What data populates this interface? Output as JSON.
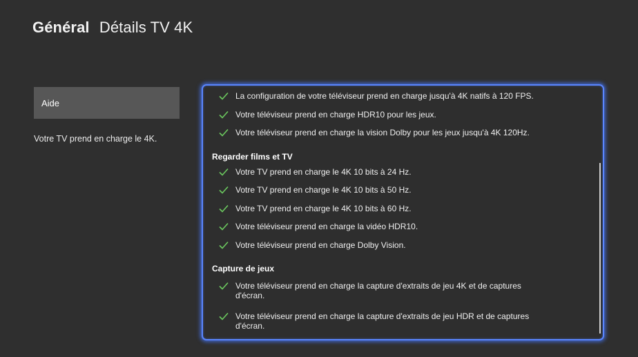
{
  "header": {
    "section": "Général",
    "page": "Détails TV 4K"
  },
  "sidebar": {
    "help_label": "Aide",
    "help_text": "Votre TV prend en charge le 4K."
  },
  "details": {
    "top_items": [
      "La configuration de votre téléviseur prend en charge jusqu'à 4K natifs à 120 FPS.",
      "Votre téléviseur prend en charge HDR10 pour les jeux.",
      "Votre téléviseur prend en charge la vision Dolby pour les jeux jusqu'à 4K 120Hz."
    ],
    "sections": [
      {
        "title": "Regarder films et TV",
        "items": [
          "Votre TV prend en charge le 4K 10 bits à 24 Hz.",
          "Votre TV prend en charge le 4K 10 bits à 50 Hz.",
          "Votre TV prend en charge le 4K 10 bits à 60 Hz.",
          "Votre téléviseur prend en charge la vidéo HDR10.",
          "Votre téléviseur prend en charge Dolby Vision."
        ]
      },
      {
        "title": "Capture de jeux",
        "items": [
          "Votre téléviseur prend en charge la capture d'extraits de jeu 4K et de captures d'écran.",
          "Votre téléviseur prend en charge la capture d'extraits de jeu HDR et de captures d'écran."
        ]
      }
    ]
  },
  "icons": {
    "check": "check-icon"
  },
  "colors": {
    "background": "#2f2f2f",
    "focus_border": "#5a86ff",
    "check": "#6ccb5f",
    "help_button": "#575757"
  }
}
